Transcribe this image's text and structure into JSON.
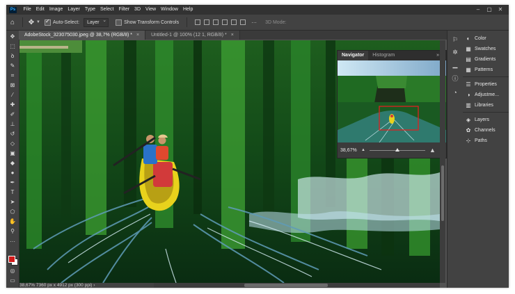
{
  "app": {
    "logo": "Ps"
  },
  "menu": [
    "File",
    "Edit",
    "Image",
    "Layer",
    "Type",
    "Select",
    "Filter",
    "3D",
    "View",
    "Window",
    "Help"
  ],
  "window_controls": {
    "minimize": "–",
    "maximize": "▢",
    "close": "✕"
  },
  "options": {
    "auto_select_label": "Auto-Select:",
    "auto_select_checked": true,
    "layer_select": "Layer",
    "show_transform_label": "Show Transform Controls",
    "show_transform_checked": false,
    "more": "···",
    "mode_3d": "3D Mode:"
  },
  "tabs": [
    {
      "label": "AdobeStock_323075030.jpeg @ 38,7% (RGB/8) *",
      "close": "×",
      "active": true
    },
    {
      "label": "Untitled-1 @ 100% (12 1, RGB/8) *",
      "close": "×",
      "active": false
    }
  ],
  "tools": [
    {
      "name": "move-tool-icon",
      "glyph": "✥"
    },
    {
      "name": "marquee-tool-icon",
      "glyph": "⬚"
    },
    {
      "name": "lasso-tool-icon",
      "glyph": "ꝺ"
    },
    {
      "name": "quick-select-tool-icon",
      "glyph": "✎"
    },
    {
      "name": "crop-tool-icon",
      "glyph": "⌗"
    },
    {
      "name": "frame-tool-icon",
      "glyph": "⊠"
    },
    {
      "name": "eyedropper-tool-icon",
      "glyph": "⁄"
    },
    {
      "name": "healing-brush-tool-icon",
      "glyph": "✚"
    },
    {
      "name": "brush-tool-icon",
      "glyph": "✐"
    },
    {
      "name": "clone-stamp-tool-icon",
      "glyph": "⊥"
    },
    {
      "name": "history-brush-tool-icon",
      "glyph": "↺"
    },
    {
      "name": "eraser-tool-icon",
      "glyph": "◇"
    },
    {
      "name": "gradient-tool-icon",
      "glyph": "▣"
    },
    {
      "name": "blur-tool-icon",
      "glyph": "◆"
    },
    {
      "name": "dodge-tool-icon",
      "glyph": "●"
    },
    {
      "name": "pen-tool-icon",
      "glyph": "✒"
    },
    {
      "name": "type-tool-icon",
      "glyph": "T"
    },
    {
      "name": "path-select-tool-icon",
      "glyph": "➤"
    },
    {
      "name": "shape-tool-icon",
      "glyph": "⬠"
    },
    {
      "name": "hand-tool-icon",
      "glyph": "✋"
    },
    {
      "name": "zoom-tool-icon",
      "glyph": "⚲"
    },
    {
      "name": "more-tools-icon",
      "glyph": "···"
    }
  ],
  "status": {
    "text": "38,67%  7360 px x 4912 px (300 ppi)  ›"
  },
  "navigator": {
    "tabs": [
      "Navigator",
      "Histogram"
    ],
    "menu": "»  ≡",
    "zoom": "38,67%",
    "zoom_fraction": 0.5
  },
  "panels": [
    {
      "icon": "color-icon",
      "glyph": "◐",
      "label": "Color"
    },
    {
      "icon": "swatches-icon",
      "glyph": "▦",
      "label": "Swatches"
    },
    {
      "icon": "gradients-icon",
      "glyph": "▤",
      "label": "Gradients"
    },
    {
      "icon": "patterns-icon",
      "glyph": "▦",
      "label": "Patterns"
    },
    {
      "icon": "properties-icon",
      "glyph": "☰",
      "label": "Properties"
    },
    {
      "icon": "adjustments-icon",
      "glyph": "◑",
      "label": "Adjustme..."
    },
    {
      "icon": "libraries-icon",
      "glyph": "▥",
      "label": "Libraries"
    },
    {
      "icon": "layers-icon",
      "glyph": "◈",
      "label": "Layers"
    },
    {
      "icon": "channels-icon",
      "glyph": "✿",
      "label": "Channels"
    },
    {
      "icon": "paths-icon",
      "glyph": "⊹",
      "label": "Paths"
    }
  ],
  "icon_strip": [
    {
      "name": "learn-icon",
      "glyph": "⚐"
    },
    {
      "name": "navigator-panel-icon",
      "glyph": "✲"
    },
    {
      "name": "histogram-panel-icon",
      "glyph": "▁"
    },
    {
      "name": "info-panel-icon",
      "glyph": "ⓘ"
    },
    {
      "name": "history-panel-icon",
      "glyph": "◔"
    }
  ]
}
